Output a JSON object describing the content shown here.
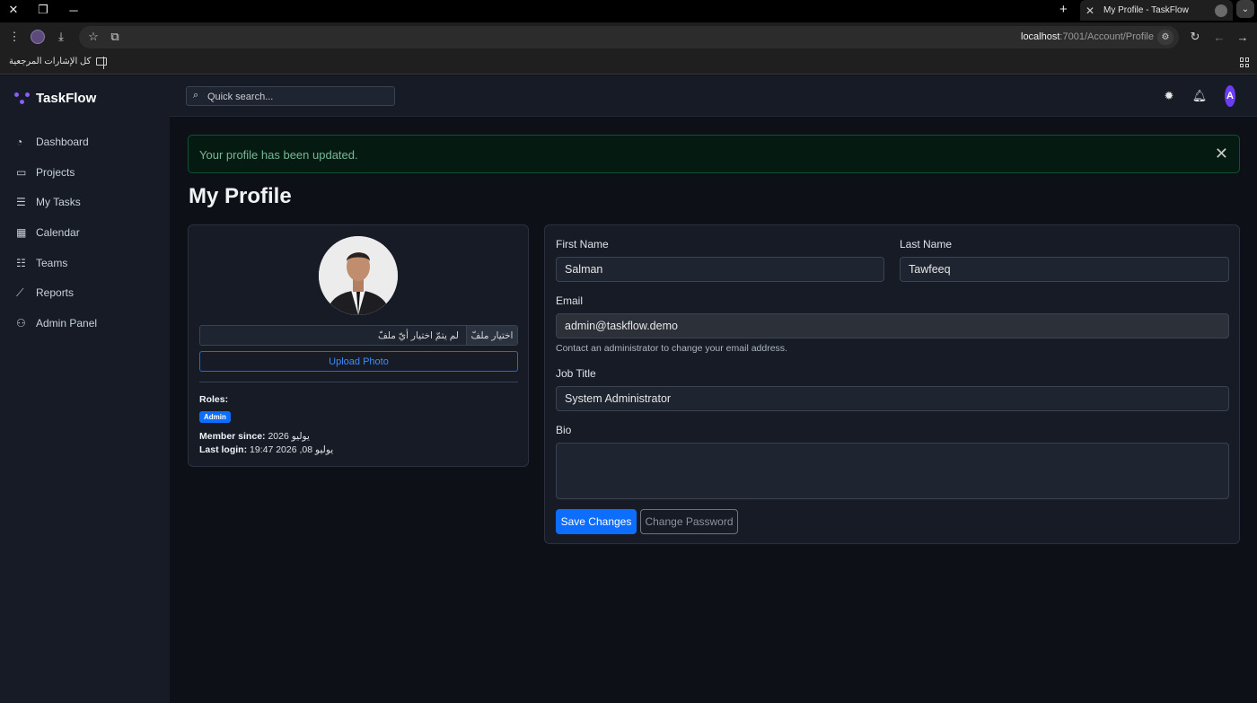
{
  "browser": {
    "tab_title": "My Profile - TaskFlow",
    "url_host": "localhost",
    "url_path": ":7001/Account/Profile",
    "bookmarks_label": "كل الإشارات المرجعية"
  },
  "app": {
    "brand": "TaskFlow",
    "accent_color": "#8b5cf6",
    "search_placeholder": "Quick search...",
    "user_initial": "A"
  },
  "sidebar": {
    "items": [
      {
        "label": "Dashboard",
        "icon": "dashboard-icon"
      },
      {
        "label": "Projects",
        "icon": "folder-icon"
      },
      {
        "label": "My Tasks",
        "icon": "tasks-icon"
      },
      {
        "label": "Calendar",
        "icon": "calendar-icon"
      },
      {
        "label": "Teams",
        "icon": "teams-icon"
      },
      {
        "label": "Reports",
        "icon": "chart-icon"
      },
      {
        "label": "Admin Panel",
        "icon": "admin-icon"
      }
    ]
  },
  "alert": {
    "message": "Your profile has been updated."
  },
  "page": {
    "title": "My Profile"
  },
  "profile_card": {
    "file_button": "اختيار ملفّ",
    "file_name": "لم يتمّ اختيار أيّ ملفّ",
    "upload_label": "Upload Photo",
    "roles_label": "Roles:",
    "role_badge": "Admin",
    "member_since_label": "Member since:",
    "member_since_value": "يوليو 2026",
    "last_login_label": "Last login:",
    "last_login_value": "يوليو 08, 2026 19:47"
  },
  "form": {
    "first_name_label": "First Name",
    "first_name_value": "Salman",
    "last_name_label": "Last Name",
    "last_name_value": "Tawfeeq",
    "email_label": "Email",
    "email_value": "admin@taskflow.demo",
    "email_help": "Contact an administrator to change your email address.",
    "job_title_label": "Job Title",
    "job_title_value": "System Administrator",
    "bio_label": "Bio",
    "bio_value": "",
    "save_label": "Save Changes",
    "change_password_label": "Change Password"
  }
}
